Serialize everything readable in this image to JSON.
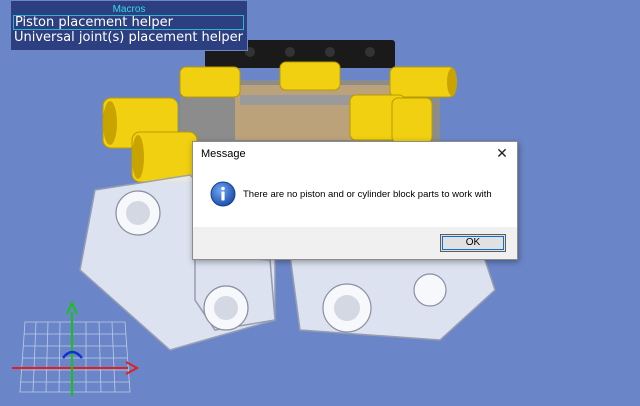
{
  "macros_panel": {
    "title": "Macros",
    "items": [
      {
        "label": "Piston placement helper"
      },
      {
        "label": "Universal joint(s) placement helper"
      }
    ]
  },
  "dialog": {
    "title": "Message",
    "message": "There are no piston and or cylinder block parts to work with",
    "ok_label": "OK",
    "close_glyph": "✕",
    "icon": "info-icon"
  },
  "colors": {
    "viewport_background": "#6b86c8",
    "macros_panel_background": "#2c3f80",
    "macros_title": "#38d8e8",
    "axis_x": "#e02020",
    "axis_y": "#18c018",
    "axis_z": "#1030d0"
  }
}
